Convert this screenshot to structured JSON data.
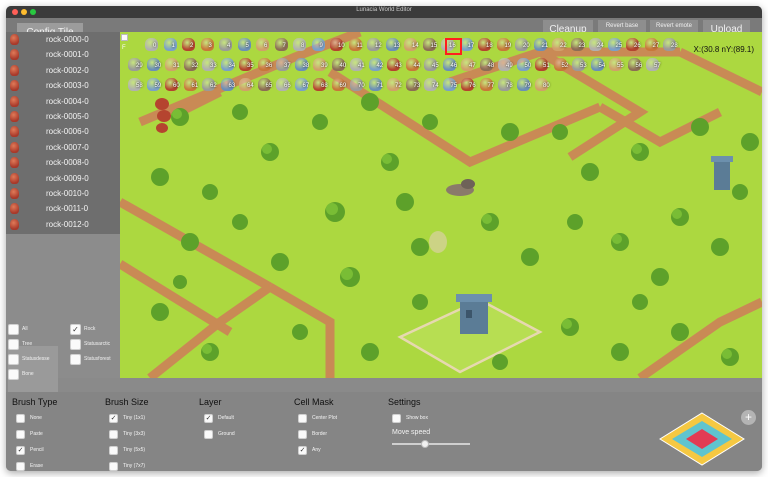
{
  "window": {
    "title": "Lunacia World Editor"
  },
  "toolbar": {
    "config_tab": "Config Tile",
    "cleanup": "Cleanup",
    "revert_base": "Revert base",
    "revert_remote": "Revert emote",
    "upload": "Upload"
  },
  "tiles": [
    "rock-0000-0",
    "rock-0001-0",
    "rock-0002-0",
    "rock-0003-0",
    "rock-0004-0",
    "rock-0005-0",
    "rock-0006-0",
    "rock-0007-0",
    "rock-0008-0",
    "rock-0009-0",
    "rock-0010-0",
    "rock-0011-0",
    "rock-0012-0"
  ],
  "filters": {
    "all": {
      "label": "All",
      "checked": false
    },
    "rock": {
      "label": "Rock",
      "checked": true
    },
    "tree": {
      "label": "Tree",
      "checked": false
    },
    "statusarctic": {
      "label": "Statusarctic",
      "checked": false
    },
    "statusdesert": {
      "label": "Statusdesse",
      "checked": false
    },
    "statusforest": {
      "label": "Statusforest",
      "checked": false
    },
    "bone": {
      "label": "Bone",
      "checked": false
    }
  },
  "palette": {
    "check_label": "F",
    "row1": [
      "0",
      "1",
      "2",
      "3",
      "4",
      "5",
      "6",
      "7",
      "8",
      "9",
      "10",
      "11",
      "12",
      "13",
      "14",
      "15",
      "16",
      "17",
      "18",
      "19",
      "20",
      "21",
      "22",
      "23",
      "24",
      "25",
      "26",
      "27",
      "28"
    ],
    "row2": [
      "29",
      "30",
      "31",
      "32",
      "33",
      "34",
      "35",
      "36",
      "37",
      "38",
      "39",
      "40",
      "41",
      "42",
      "43",
      "44",
      "45",
      "46",
      "47",
      "48",
      "49",
      "50",
      "51",
      "52",
      "53",
      "54",
      "55",
      "56",
      "57"
    ],
    "row3": [
      "58",
      "59",
      "60",
      "61",
      "62",
      "63",
      "64",
      "65",
      "66",
      "67",
      "68",
      "69",
      "70",
      "71",
      "72",
      "73",
      "74",
      "75",
      "76",
      "77",
      "78",
      "79",
      "80"
    ]
  },
  "coords": "X:(30.8 nY:(89.1)",
  "brush_type": {
    "title": "Brush Type",
    "options": [
      {
        "label": "None",
        "checked": false
      },
      {
        "label": "Paste",
        "checked": false
      },
      {
        "label": "Pencil",
        "checked": true
      },
      {
        "label": "Erase",
        "checked": false
      }
    ]
  },
  "brush_size": {
    "title": "Brush Size",
    "options": [
      {
        "label": "Tiny (1x1)",
        "checked": true
      },
      {
        "label": "Tiny (3x3)",
        "checked": false
      },
      {
        "label": "Tiny (5x5)",
        "checked": false
      },
      {
        "label": "Tiny (7x7)",
        "checked": false
      }
    ]
  },
  "layer": {
    "title": "Layer",
    "options": [
      {
        "label": "Default",
        "checked": true
      },
      {
        "label": "Ground",
        "checked": false
      }
    ]
  },
  "cell_mask": {
    "title": "Cell Mask",
    "options": [
      {
        "label": "Center Plot",
        "checked": false
      },
      {
        "label": "Border",
        "checked": false
      },
      {
        "label": "Any",
        "checked": true
      }
    ]
  },
  "settings": {
    "title": "Settings",
    "show_box": {
      "label": "Show box",
      "checked": false
    },
    "move_speed_label": "Move speed",
    "move_speed": 0.42
  },
  "minimap_add": "+",
  "colors": {
    "grass": "#a8d63c",
    "dirt_path": "#c98a55",
    "rock": "#b5442f",
    "panel": "#858585",
    "selection": "#ff1e1e"
  }
}
